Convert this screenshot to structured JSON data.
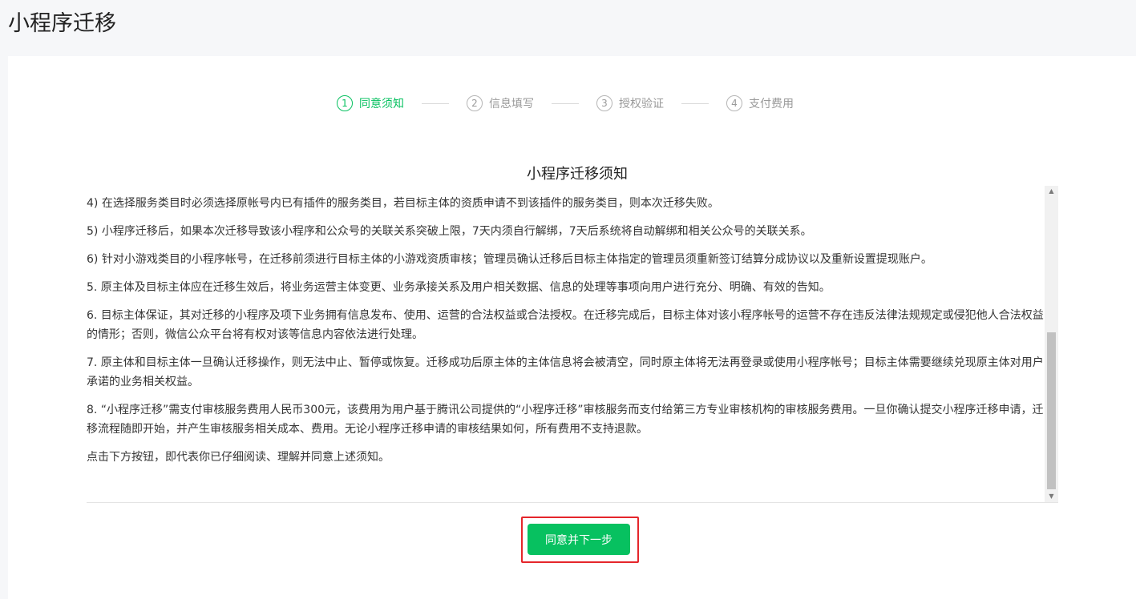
{
  "header": {
    "title": "小程序迁移"
  },
  "steps": [
    {
      "num": "1",
      "label": "同意须知",
      "active": true
    },
    {
      "num": "2",
      "label": "信息填写",
      "active": false
    },
    {
      "num": "3",
      "label": "授权验证",
      "active": false
    },
    {
      "num": "4",
      "label": "支付费用",
      "active": false
    }
  ],
  "notice": {
    "title": "小程序迁移须知",
    "paragraphs": [
      "4) 在选择服务类目时必须选择原帐号内已有插件的服务类目，若目标主体的资质申请不到该插件的服务类目，则本次迁移失败。",
      "5) 小程序迁移后，如果本次迁移导致该小程序和公众号的关联关系突破上限，7天内须自行解绑，7天后系统将自动解绑和相关公众号的关联关系。",
      "6) 针对小游戏类目的小程序帐号，在迁移前须进行目标主体的小游戏资质审核；管理员确认迁移后目标主体指定的管理员须重新签订结算分成协议以及重新设置提现账户。",
      "5. 原主体及目标主体应在迁移生效后，将业务运营主体变更、业务承接关系及用户相关数据、信息的处理等事项向用户进行充分、明确、有效的告知。",
      "6. 目标主体保证，其对迁移的小程序及项下业务拥有信息发布、使用、运营的合法权益或合法授权。在迁移完成后，目标主体对该小程序帐号的运营不存在违反法律法规规定或侵犯他人合法权益的情形；否则，微信公众平台将有权对该等信息内容依法进行处理。",
      "7. 原主体和目标主体一旦确认迁移操作，则无法中止、暂停或恢复。迁移成功后原主体的主体信息将会被清空，同时原主体将无法再登录或使用小程序帐号；目标主体需要继续兑现原主体对用户承诺的业务相关权益。",
      "8. “小程序迁移”需支付审核服务费用人民币300元，该费用为用户基于腾讯公司提供的“小程序迁移”审核服务而支付给第三方专业审核机构的审核服务费用。一旦你确认提交小程序迁移申请，迁移流程随即开始，并产生审核服务相关成本、费用。无论小程序迁移申请的审核结果如何，所有费用不支持退款。",
      "点击下方按钮，即代表你已仔细阅读、理解并同意上述须知。"
    ]
  },
  "actions": {
    "agree_next": "同意并下一步"
  },
  "colors": {
    "accent": "#07c160",
    "highlight": "#e5262b"
  }
}
